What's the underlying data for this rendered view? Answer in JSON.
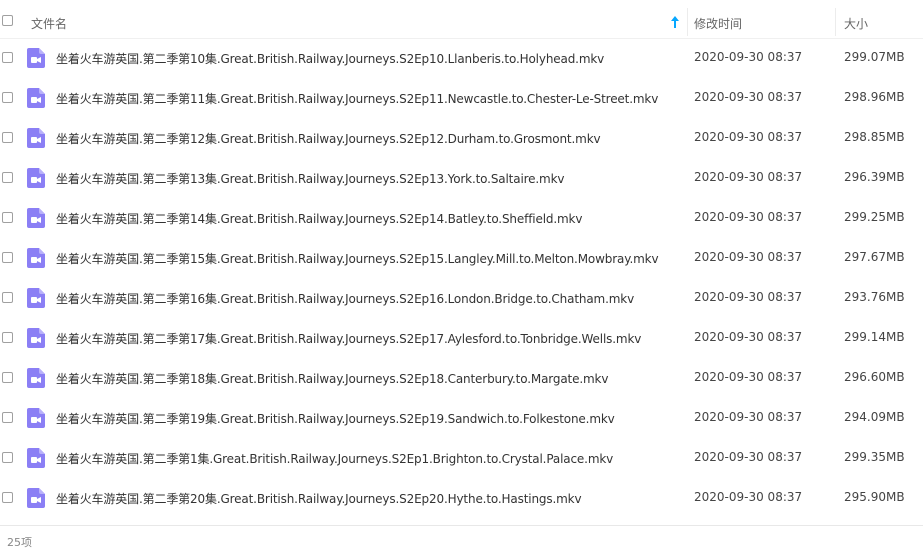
{
  "header": {
    "name_label": "文件名",
    "time_label": "修改时间",
    "size_label": "大小"
  },
  "colors": {
    "video_icon": "#8b7ff5",
    "sort_arrow": "#06a7ff"
  },
  "files": [
    {
      "name": "坐着火车游英国.第二季第10集.Great.British.Railway.Journeys.S2Ep10.Llanberis.to.Holyhead.mkv",
      "time": "2020-09-30 08:37",
      "size": "299.07MB"
    },
    {
      "name": "坐着火车游英国.第二季第11集.Great.British.Railway.Journeys.S2Ep11.Newcastle.to.Chester-Le-Street.mkv",
      "time": "2020-09-30 08:37",
      "size": "298.96MB"
    },
    {
      "name": "坐着火车游英国.第二季第12集.Great.British.Railway.Journeys.S2Ep12.Durham.to.Grosmont.mkv",
      "time": "2020-09-30 08:37",
      "size": "298.85MB"
    },
    {
      "name": "坐着火车游英国.第二季第13集.Great.British.Railway.Journeys.S2Ep13.York.to.Saltaire.mkv",
      "time": "2020-09-30 08:37",
      "size": "296.39MB"
    },
    {
      "name": "坐着火车游英国.第二季第14集.Great.British.Railway.Journeys.S2Ep14.Batley.to.Sheffield.mkv",
      "time": "2020-09-30 08:37",
      "size": "299.25MB"
    },
    {
      "name": "坐着火车游英国.第二季第15集.Great.British.Railway.Journeys.S2Ep15.Langley.Mill.to.Melton.Mowbray.mkv",
      "time": "2020-09-30 08:37",
      "size": "297.67MB"
    },
    {
      "name": "坐着火车游英国.第二季第16集.Great.British.Railway.Journeys.S2Ep16.London.Bridge.to.Chatham.mkv",
      "time": "2020-09-30 08:37",
      "size": "293.76MB"
    },
    {
      "name": "坐着火车游英国.第二季第17集.Great.British.Railway.Journeys.S2Ep17.Aylesford.to.Tonbridge.Wells.mkv",
      "time": "2020-09-30 08:37",
      "size": "299.14MB"
    },
    {
      "name": "坐着火车游英国.第二季第18集.Great.British.Railway.Journeys.S2Ep18.Canterbury.to.Margate.mkv",
      "time": "2020-09-30 08:37",
      "size": "296.60MB"
    },
    {
      "name": "坐着火车游英国.第二季第19集.Great.British.Railway.Journeys.S2Ep19.Sandwich.to.Folkestone.mkv",
      "time": "2020-09-30 08:37",
      "size": "294.09MB"
    },
    {
      "name": "坐着火车游英国.第二季第1集.Great.British.Railway.Journeys.S2Ep1.Brighton.to.Crystal.Palace.mkv",
      "time": "2020-09-30 08:37",
      "size": "299.35MB"
    },
    {
      "name": "坐着火车游英国.第二季第20集.Great.British.Railway.Journeys.S2Ep20.Hythe.to.Hastings.mkv",
      "time": "2020-09-30 08:37",
      "size": "295.90MB"
    }
  ],
  "footer": {
    "count": "25项"
  }
}
